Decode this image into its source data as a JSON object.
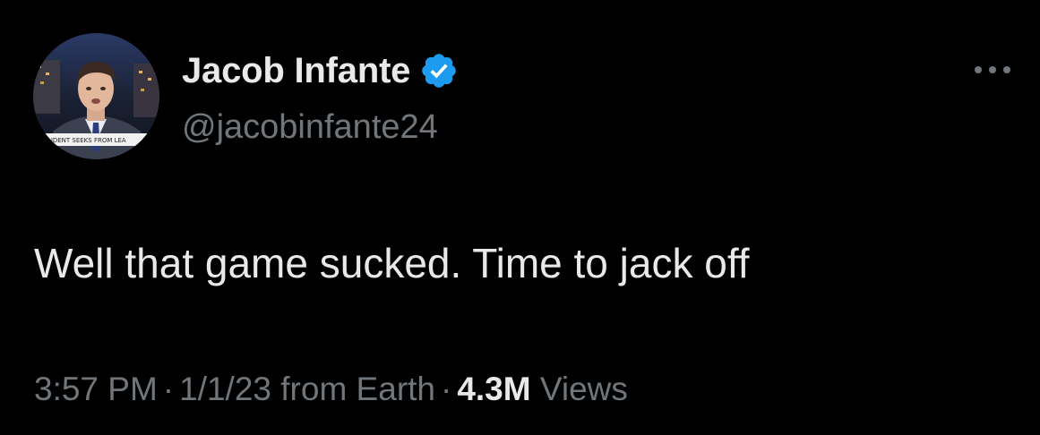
{
  "author": {
    "display_name": "Jacob Infante",
    "handle": "@jacobinfante24",
    "verified": true,
    "verified_icon": "verified-badge-icon",
    "avatar_ticker": "STUDENT SEEKS FROM LEA",
    "verified_color": "#1d9bf0"
  },
  "tweet": {
    "text": "Well that game sucked. Time to jack off"
  },
  "meta": {
    "time": "3:57 PM",
    "separator": "·",
    "date": "1/1/23",
    "source": "from Earth",
    "views_count": "4.3M",
    "views_label": "Views"
  },
  "actions": {
    "more_icon": "more-options-icon"
  },
  "colors": {
    "background": "#000000",
    "primary_text": "#e7e9ea",
    "secondary_text": "#71767b"
  }
}
